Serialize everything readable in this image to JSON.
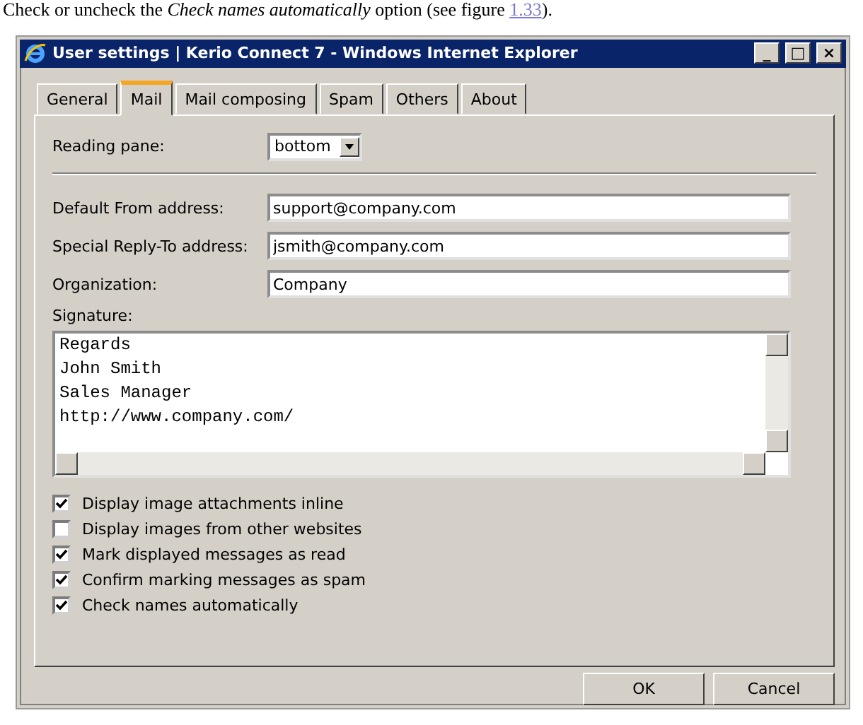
{
  "caption": {
    "text": "Check or uncheck the *Check names automatically* option (see figure",
    "link": "1.33",
    "end": ")."
  },
  "window": {
    "title": "User settings | Kerio Connect 7 - Windows Internet Explorer",
    "controls": [
      "_",
      "□",
      "×"
    ]
  },
  "tabs": [
    {
      "label": "General",
      "selected": false
    },
    {
      "label": "Mail",
      "selected": true
    },
    {
      "label": "Mail composing",
      "selected": false
    },
    {
      "label": "Spam",
      "selected": false
    },
    {
      "label": "Others",
      "selected": false
    },
    {
      "label": "About",
      "selected": false
    }
  ],
  "reading_pane": {
    "label": "Reading pane:",
    "value": "bottom"
  },
  "fields": [
    {
      "label": "Default From address:",
      "value": "support@company.com"
    },
    {
      "label": "Special Reply-To address:",
      "value": "jsmith@company.com"
    },
    {
      "label": "Organization:",
      "value": "Company"
    }
  ],
  "signature": {
    "label": "Signature:",
    "lines": [
      "Regards",
      "John Smith",
      "Sales Manager",
      "http://www.company.com/"
    ]
  },
  "options": [
    {
      "label": "Display image attachments inline",
      "checked": true
    },
    {
      "label": "Display images from other websites",
      "checked": false
    },
    {
      "label": "Mark displayed messages as read",
      "checked": true
    },
    {
      "label": "Confirm marking messages as spam",
      "checked": true
    },
    {
      "label": "Check names automatically",
      "checked": true
    }
  ],
  "buttons": [
    "OK",
    "Cancel"
  ]
}
